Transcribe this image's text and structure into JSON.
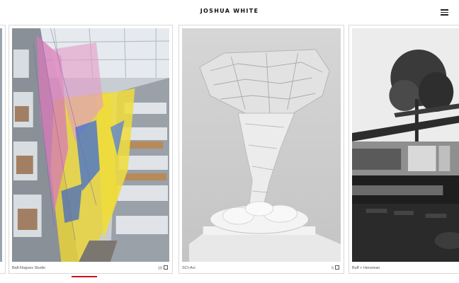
{
  "header": {
    "title": "JOSHUA WHITE",
    "menu_icon": "hamburger-menu-icon"
  },
  "projects": [
    {
      "caption": "Ball-Nogues Studio",
      "count": "10",
      "image": "atrium-installation-photo"
    },
    {
      "caption": "SCI-Arc",
      "count": "5",
      "image": "tornado-sculpture-photo"
    },
    {
      "caption": "Buff + Hensman",
      "image": "modern-house-pool-photo"
    }
  ],
  "colors": {
    "accent": "#d0121b"
  }
}
